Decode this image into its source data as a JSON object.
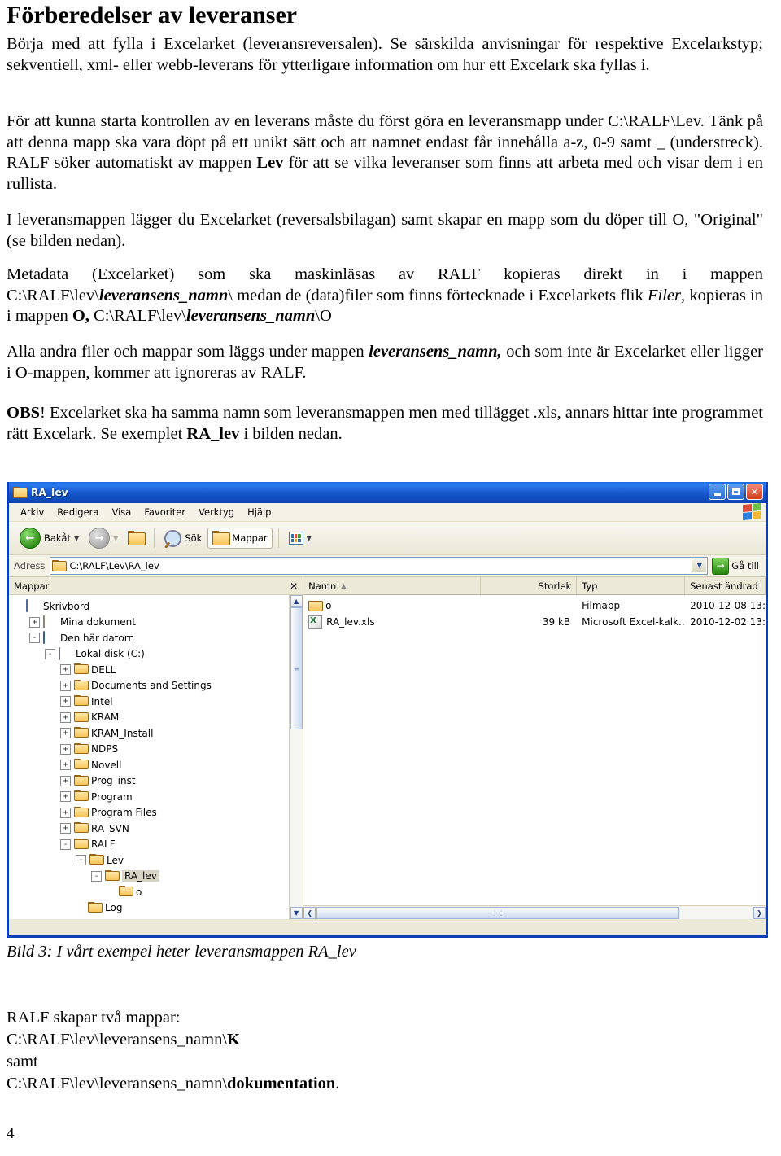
{
  "document": {
    "title": "Förberedelser av leveranser",
    "page_number": "4",
    "paragraphs": {
      "p1": "Börja med att fylla i Excelarket (leveransreversalen). Se särskilda anvisningar för respektive Excelarkstyp; sekventiell, xml- eller webb-leverans för ytterligare information om hur ett Excelark ska fyllas i.",
      "p2_a": "För att kunna starta kontrollen av en leverans måste du först göra en leveransmapp under C:\\RALF\\Lev. Tänk på att denna mapp ska vara döpt på ett unikt sätt och att namnet endast får innehålla a-z, 0-9 samt _ (understreck). RALF söker automatiskt av mappen ",
      "p2_bold": "Lev",
      "p2_b": " för att se vilka leveranser som finns att arbeta med och visar dem i en rullista.",
      "p3": "I leveransmappen lägger du Excelarket (reversalsbilagan) samt skapar en mapp som du döper till O, \"Original\" (se bilden nedan).",
      "p4_a": "Metadata (Excelarket) som ska maskinläsas av RALF kopieras direkt in i mappen C:\\RALF\\lev\\",
      "p4_bi1": "leveransens_namn",
      "p4_b": "\\ medan de (data)filer som finns förtecknade i Excelarkets flik ",
      "p4_i1": "Filer",
      "p4_c": ", kopieras in i mappen ",
      "p4_bold1": "O,",
      "p4_d": " C:\\RALF\\lev\\",
      "p4_bi2": "leveransens_namn",
      "p4_e": "\\O",
      "p5_a": "Alla andra filer och mappar som läggs under mappen ",
      "p5_bi": "leveransens_namn,",
      "p5_b": " och som inte är Excelarket eller ligger i  O-mappen, kommer att ignoreras av RALF.",
      "p6_bold1": "OBS",
      "p6_a": "! Excelarket ska ha samma namn som leveransmappen men med tillägget .xls, annars hittar inte programmet rätt Excelark. Se exemplet ",
      "p6_bold2": "RA_lev",
      "p6_b": " i bilden nedan."
    },
    "caption": "Bild 3: I vårt exempel heter leveransmappen RA_lev",
    "footer": {
      "line1": "RALF skapar två mappar:",
      "line2_a": "C:\\RALF\\lev\\leveransens_namn\\",
      "line2_bold": "K",
      "line3": "samt",
      "line4_a": "C:\\RALF\\lev\\leveransens_namn\\",
      "line4_bold": "dokumentation",
      "line4_b": "."
    }
  },
  "explorer": {
    "window_title": "RA_lev",
    "title_icon": "folder-icon",
    "window_buttons": {
      "minimize": "minimize-icon",
      "maximize": "maximize-icon",
      "close": "✕"
    },
    "menu": [
      {
        "label": "Arkiv",
        "accel": "A"
      },
      {
        "label": "Redigera",
        "accel": "R"
      },
      {
        "label": "Visa",
        "accel": "s"
      },
      {
        "label": "Favoriter",
        "accel": "F"
      },
      {
        "label": "Verktyg",
        "accel": "V"
      },
      {
        "label": "Hjälp",
        "accel": "H"
      }
    ],
    "toolbar": {
      "back_label": "Bakåt",
      "back_icon": "back-arrow-icon",
      "forward_icon": "forward-arrow-icon",
      "up_icon": "up-folder-icon",
      "search_label": "Sök",
      "search_icon": "magnifier-icon",
      "folders_label": "Mappar",
      "folders_icon": "folders-icon",
      "views_icon": "views-icon",
      "dropdown_caret": "▼"
    },
    "address": {
      "label": "Adress",
      "icon": "folder-icon",
      "value": "C:\\RALF\\Lev\\RA_lev",
      "dropdown_caret": "▼",
      "go_label": "Gå till",
      "go_icon": "green-arrow-icon"
    },
    "tree_pane": {
      "header": "Mappar",
      "close_label": "✕",
      "items": [
        {
          "label": "Skrivbord",
          "indent": 0,
          "expander": "",
          "icon": "desktop-icon",
          "selected": false
        },
        {
          "label": "Mina dokument",
          "indent": 1,
          "expander": "+",
          "icon": "documents-icon",
          "selected": false
        },
        {
          "label": "Den här datorn",
          "indent": 1,
          "expander": "-",
          "icon": "computer-icon",
          "selected": false
        },
        {
          "label": "Lokal disk (C:)",
          "indent": 2,
          "expander": "-",
          "icon": "disk-icon",
          "selected": false
        },
        {
          "label": "DELL",
          "indent": 3,
          "expander": "+",
          "icon": "folder-icon",
          "selected": false
        },
        {
          "label": "Documents and Settings",
          "indent": 3,
          "expander": "+",
          "icon": "folder-icon",
          "selected": false
        },
        {
          "label": "Intel",
          "indent": 3,
          "expander": "+",
          "icon": "folder-icon",
          "selected": false
        },
        {
          "label": "KRAM",
          "indent": 3,
          "expander": "+",
          "icon": "folder-icon",
          "selected": false
        },
        {
          "label": "KRAM_Install",
          "indent": 3,
          "expander": "+",
          "icon": "folder-icon",
          "selected": false
        },
        {
          "label": "NDPS",
          "indent": 3,
          "expander": "+",
          "icon": "folder-icon",
          "selected": false
        },
        {
          "label": "Novell",
          "indent": 3,
          "expander": "+",
          "icon": "folder-icon",
          "selected": false
        },
        {
          "label": "Prog_inst",
          "indent": 3,
          "expander": "+",
          "icon": "folder-icon",
          "selected": false
        },
        {
          "label": "Program",
          "indent": 3,
          "expander": "+",
          "icon": "folder-icon",
          "selected": false
        },
        {
          "label": "Program Files",
          "indent": 3,
          "expander": "+",
          "icon": "folder-icon",
          "selected": false
        },
        {
          "label": "RA_SVN",
          "indent": 3,
          "expander": "+",
          "icon": "folder-icon",
          "selected": false
        },
        {
          "label": "RALF",
          "indent": 3,
          "expander": "-",
          "icon": "folder-icon",
          "selected": false
        },
        {
          "label": "Lev",
          "indent": 4,
          "expander": "-",
          "icon": "folder-icon",
          "selected": false
        },
        {
          "label": "RA_lev",
          "indent": 5,
          "expander": "-",
          "icon": "folder-icon",
          "selected": true
        },
        {
          "label": "o",
          "indent": 6,
          "expander": "",
          "icon": "folder-icon",
          "selected": false
        },
        {
          "label": "Log",
          "indent": 4,
          "expander": "",
          "icon": "folder-icon",
          "selected": false
        }
      ],
      "scrollbar": {
        "up": "▲",
        "down": "▼",
        "grip": "≡"
      }
    },
    "file_pane": {
      "columns": [
        {
          "label": "Namn",
          "sort": "▲"
        },
        {
          "label": "Storlek",
          "sort": ""
        },
        {
          "label": "Typ",
          "sort": ""
        },
        {
          "label": "Senast ändrad",
          "sort": ""
        }
      ],
      "rows": [
        {
          "name": "o",
          "icon": "folder-icon",
          "size": "",
          "type": "Filmapp",
          "modified": "2010-12-08 13:"
        },
        {
          "name": "RA_lev.xls",
          "icon": "excel-icon",
          "size": "39 kB",
          "type": "Microsoft Excel-kalk...",
          "modified": "2010-12-02 13:"
        }
      ],
      "hscrollbar": {
        "left": "❮",
        "right": "❯",
        "grip": "⋮⋮"
      }
    },
    "colors": {
      "title_bar": "#0a3fb5",
      "chrome": "#ece9d8",
      "selection": "#d8d4c4",
      "accent_green": "#25860f"
    }
  }
}
